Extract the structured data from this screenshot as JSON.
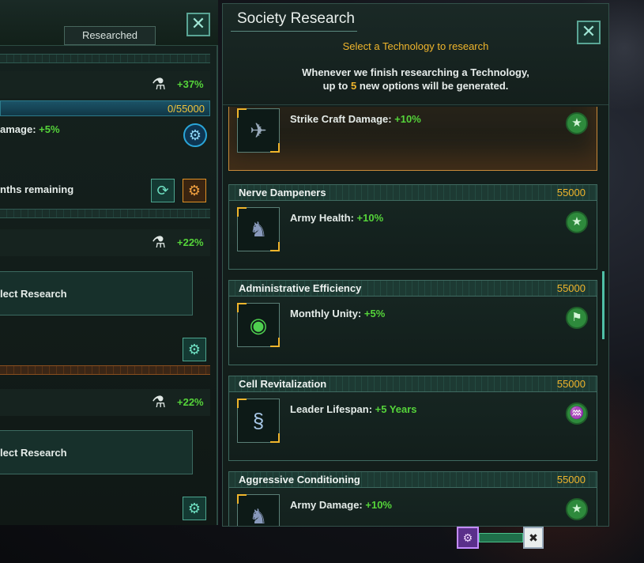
{
  "left_panel": {
    "researched_tab": "Researched",
    "close_label": "✕",
    "rows": [
      {
        "pct": "+37%"
      },
      {
        "pct": "+22%"
      },
      {
        "pct": "+22%"
      }
    ],
    "progress": "0/55000",
    "damage_text": "amage: ",
    "damage_value": "+5%",
    "months_text": "nths remaining",
    "select_research_1": "lect Research",
    "select_research_2": "lect Research"
  },
  "right_panel": {
    "title": "Society Research",
    "close_label": "✕",
    "subtitle": "Select a Technology to research",
    "desc_line1": "Whenever we finish researching a Technology,",
    "desc_line2_pre": "up to ",
    "desc_line2_num": "5",
    "desc_line2_post": " new options will be generated.",
    "cards": [
      {
        "name": "",
        "cost": "",
        "effect_label": "Strike Craft Damage: ",
        "effect_value": "+10%",
        "badge": "army",
        "image": "strike-craft"
      },
      {
        "name": "Nerve Dampeners",
        "cost": "55000",
        "effect_label": "Army Health: ",
        "effect_value": "+10%",
        "badge": "army",
        "image": "soldier"
      },
      {
        "name": "Administrative Efficiency",
        "cost": "55000",
        "effect_label": "Monthly Unity: ",
        "effect_value": "+5%",
        "badge": "statecraft",
        "image": "globe"
      },
      {
        "name": "Cell Revitalization",
        "cost": "55000",
        "effect_label": "Leader Lifespan: ",
        "effect_value": "+5 Years",
        "badge": "biology",
        "image": "dna"
      },
      {
        "name": "Aggressive Conditioning",
        "cost": "55000",
        "effect_label": "Army Damage: ",
        "effect_value": "+10%",
        "badge": "army",
        "image": "soldier"
      }
    ]
  },
  "colors": {
    "accent_gold": "#f0b52c",
    "positive_green": "#55d43a",
    "panel_border": "#3f6a60"
  }
}
